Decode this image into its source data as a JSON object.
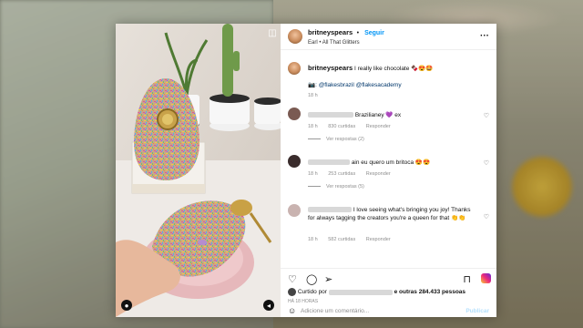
{
  "post": {
    "username": "britneyspears",
    "follow_label": "Seguir",
    "subtitle": "Earl • All That Glitters",
    "caption": "I really like chocolate 🍫😍🤩",
    "caption_mentions": "📷: @flakesbrazil @flakesacademy",
    "caption_time": "18 h"
  },
  "comments": [
    {
      "text": "Brazilianey 💜 ex",
      "time": "18 h",
      "likes": "830 curtidas",
      "reply": "Responder",
      "view_replies": "Ver respostas (2)"
    },
    {
      "text": "ain eu quero um britoca 😍😍",
      "time": "18 h",
      "likes": "253 curtidas",
      "reply": "Responder",
      "view_replies": "Ver respostas (5)"
    },
    {
      "text": "I love seeing what's bringing you joy! Thanks for always tagging the creators you're a queen for that 👏👏",
      "time": "18 h",
      "likes": "582 curtidas",
      "reply": "Responder"
    }
  ],
  "likes_line": "outras 284.433 pessoas",
  "likes_prefix": "Curtido por",
  "post_date": "HÁ 18 HORAS",
  "composer": {
    "placeholder": "Adicione um comentário...",
    "publish": "Publicar",
    "emoji_icon": "emoji-icon"
  },
  "icons": [
    "heart-icon",
    "comment-icon",
    "share-icon",
    "bookmark-icon",
    "more-icon",
    "camera-icon",
    "user-tag-icon",
    "mute-icon"
  ],
  "colors": {
    "follow": "#0095f6",
    "link": "#00376b",
    "muted": "#8e8e8e",
    "publish_disabled": "#b3dffc"
  }
}
